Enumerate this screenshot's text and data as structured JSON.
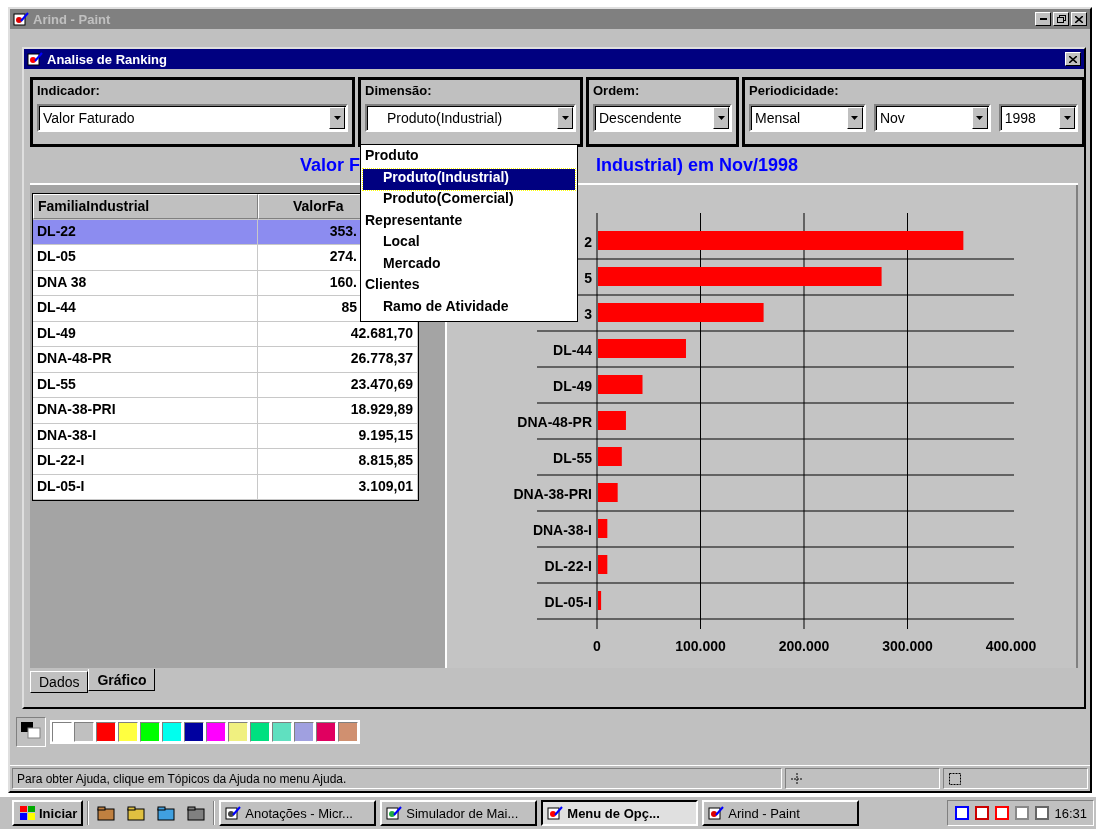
{
  "paint_window": {
    "title": "Arind - Paint"
  },
  "dialog": {
    "title": "Analise de Ranking",
    "filters": [
      {
        "label": "Indicador:",
        "combos": [
          {
            "value": "Valor Faturado"
          }
        ]
      },
      {
        "label": "Dimensão:",
        "combos": [
          {
            "value": "Produto(Industrial)"
          }
        ]
      },
      {
        "label": "Ordem:",
        "combos": [
          {
            "value": "Descendente"
          }
        ]
      },
      {
        "label": "Periodicidade:",
        "combos": [
          {
            "value": "Mensal"
          },
          {
            "value": "Nov"
          },
          {
            "value": "1998"
          }
        ]
      }
    ],
    "dropdown": {
      "items": [
        {
          "label": "Produto",
          "children": [
            {
              "label": "Produto(Industrial)",
              "selected": true
            },
            {
              "label": "Produto(Comercial)",
              "selected": false
            }
          ],
          "selected": false
        },
        {
          "label": "Representante",
          "children": [
            {
              "label": "Local",
              "selected": false
            },
            {
              "label": "Mercado",
              "selected": false
            }
          ],
          "selected": false
        },
        {
          "label": "Clientes",
          "children": [
            {
              "label": "Ramo de Atividade",
              "selected": false
            }
          ],
          "selected": false
        }
      ]
    },
    "chart_title": [
      "Valor F",
      "Industrial) em Nov/1998"
    ],
    "table": {
      "columns": [
        "FamiliaIndustrial",
        "ValorFa"
      ],
      "rows": [
        {
          "kind": "partial",
          "cells": [
            "DL-22",
            "353."
          ],
          "selected": true
        },
        {
          "kind": "partial",
          "cells": [
            "DL-05",
            "274."
          ],
          "selected": false
        },
        {
          "kind": "partial",
          "cells": [
            "DNA 38",
            "160."
          ],
          "selected": false
        },
        {
          "kind": "partial",
          "cells": [
            "DL-44",
            "85"
          ],
          "selected": false
        },
        {
          "kind": "full",
          "cells": [
            "DL-49",
            "42.681,70"
          ],
          "selected": false
        },
        {
          "kind": "full",
          "cells": [
            "DNA-48-PR",
            "26.778,37"
          ],
          "selected": false
        },
        {
          "kind": "full",
          "cells": [
            "DL-55",
            "23.470,69"
          ],
          "selected": false
        },
        {
          "kind": "full",
          "cells": [
            "DNA-38-PRI",
            "18.929,89"
          ],
          "selected": false
        },
        {
          "kind": "full",
          "cells": [
            "DNA-38-I",
            "9.195,15"
          ],
          "selected": false
        },
        {
          "kind": "full",
          "cells": [
            "DL-22-I",
            "8.815,85"
          ],
          "selected": false
        },
        {
          "kind": "full",
          "cells": [
            "DL-05-I",
            "3.109,01"
          ],
          "selected": false
        }
      ]
    },
    "chart_data": {
      "type": "bar",
      "orientation": "horizontal",
      "grid": true,
      "categories": [
        "2",
        "5",
        "3",
        "DL-44",
        "DL-49",
        "DNA-48-PR",
        "DL-55",
        "DNA-38-PRI",
        "DNA-38-I",
        "DL-22-I",
        "DL-05-I"
      ],
      "series": [
        {
          "color": "#ff0000",
          "values": [
            353000,
            274000,
            160000,
            85000,
            43000,
            27000,
            23000,
            19000,
            9000,
            9000,
            3000
          ]
        }
      ],
      "xlim": [
        0,
        400000
      ],
      "xticks": [
        {
          "value": 0,
          "label": "0"
        },
        {
          "value": 100000,
          "label": "100.000"
        },
        {
          "value": 200000,
          "label": "200.000"
        },
        {
          "value": 300000,
          "label": "300.000"
        },
        {
          "value": 400000,
          "label": "400.000"
        }
      ]
    },
    "tabs": [
      {
        "label": "Dados",
        "selected": false
      },
      {
        "label": "Gráfico",
        "selected": true
      }
    ]
  },
  "palette": [
    {
      "color": "#ffffff"
    },
    {
      "color": "#c0c0c0"
    },
    {
      "color": "#ff0000"
    },
    {
      "color": "#ffff40"
    },
    {
      "color": "#00ff00"
    },
    {
      "color": "#00ffee"
    },
    {
      "color": "#0000a0"
    },
    {
      "color": "#ff00ff"
    },
    {
      "color": "#f0f080"
    },
    {
      "color": "#00e080"
    },
    {
      "color": "#60e0c0"
    },
    {
      "color": "#a0a0e0"
    },
    {
      "color": "#e00060"
    },
    {
      "color": "#d09070"
    }
  ],
  "status_bar": {
    "text": "Para obter Ajuda, clique em Tópicos da Ajuda no menu Ajuda."
  },
  "taskbar": {
    "start": "Iniciar",
    "tasks": [
      {
        "label": "Anotações - Micr...",
        "selected": false
      },
      {
        "label": "Simulador de Mai...",
        "selected": false
      },
      {
        "label": "Menu de Opç...",
        "selected": true
      },
      {
        "label": "Arind - Paint",
        "selected": false
      }
    ],
    "clock": "16:31"
  }
}
